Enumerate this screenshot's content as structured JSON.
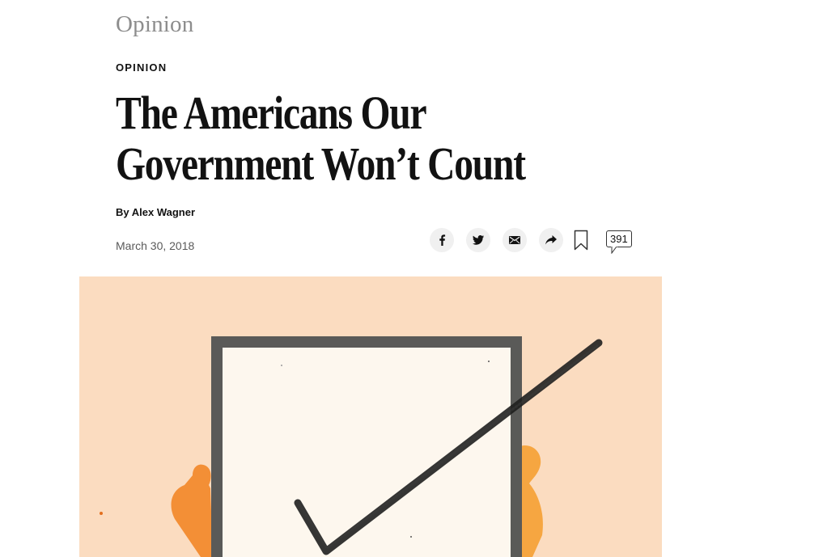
{
  "masthead": {
    "section_logo": "Opinion"
  },
  "article": {
    "kicker": "OPINION",
    "headline_line1": "The Americans Our",
    "headline_line2": "Government Won’t Count",
    "byline_prefix": "By",
    "author": "Alex Wagner",
    "date": "March 30, 2018"
  },
  "share": {
    "icons": [
      "facebook-icon",
      "twitter-icon",
      "email-icon",
      "share-icon",
      "bookmark-icon",
      "comment-icon"
    ],
    "comment_count": "391"
  },
  "hero_image": {
    "colors": {
      "background": "#fbdcc0",
      "frame": "#555555",
      "panel": "#fdf7ee",
      "figure": "#f28a2e",
      "check": "#222222"
    }
  }
}
